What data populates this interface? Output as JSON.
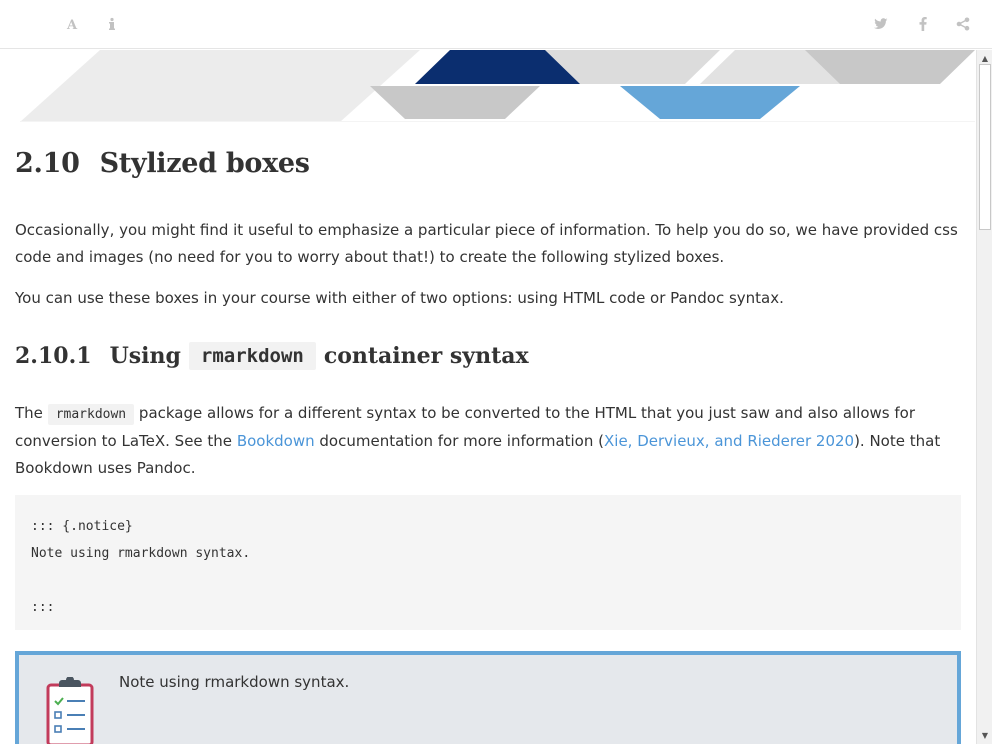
{
  "toolbar": {
    "left_icons": [
      "font-icon",
      "info-icon"
    ],
    "right_icons": [
      "twitter-icon",
      "facebook-icon",
      "share-icon"
    ]
  },
  "colors": {
    "accent_dark_blue": "#0b2e6f",
    "accent_light_blue": "#65a6d8",
    "link": "#4b95d8",
    "banner_gray": "#cfcfcf"
  },
  "section": {
    "number": "2.10",
    "title": "Stylized boxes",
    "para1": "Occasionally, you might find it useful to emphasize a particular piece of information. To help you do so, we have provided css code and images (no need for you to worry about that!) to create the following stylized boxes.",
    "para2": "You can use these boxes in your course with either of two options: using HTML code or Pandoc syntax."
  },
  "subsection": {
    "number": "2.10.1",
    "title_before": "Using",
    "title_code": "rmarkdown",
    "title_after": "container syntax"
  },
  "para3": {
    "t1": "The",
    "code": "rmarkdown",
    "t2": "package allows for a different syntax to be converted to the HTML that you just saw and also allows for conversion to LaTeX. See the",
    "link1": "Bookdown",
    "t3": "documentation for more information (",
    "link2": "Xie, Dervieux, and Riederer 2020",
    "t4": "). Note that Bookdown uses Pandoc."
  },
  "code_block": {
    "line1": "::: {.notice}",
    "line2": "Note using rmarkdown syntax.",
    "line3": "",
    "line4": ":::"
  },
  "notice_box": {
    "icon": "clipboard-checklist-icon",
    "text": "Note using rmarkdown syntax."
  }
}
